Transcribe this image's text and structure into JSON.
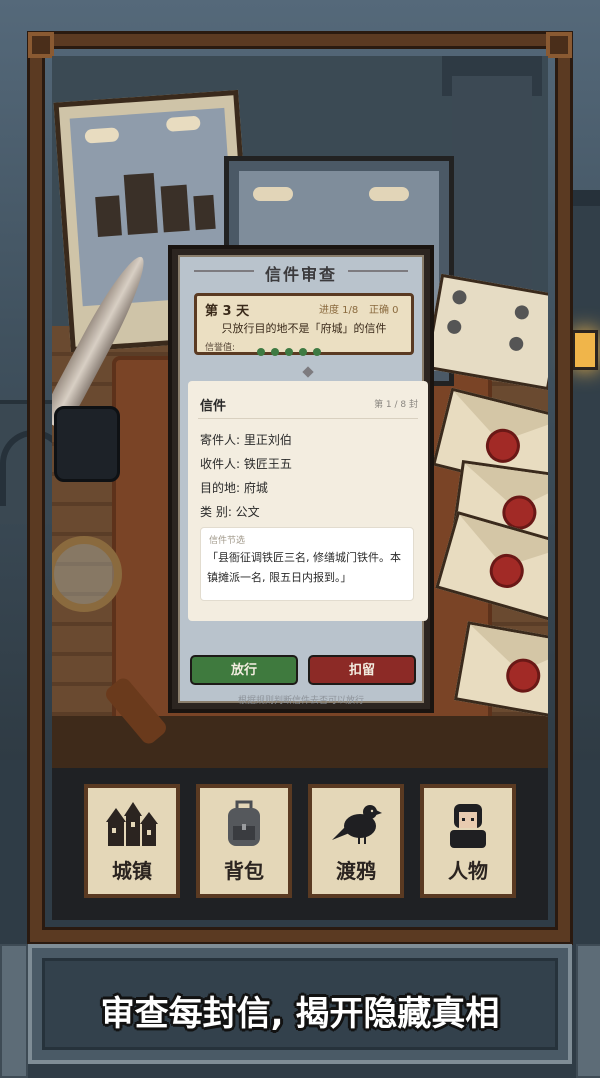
{
  "panel": {
    "title": "信件审查",
    "day": {
      "label": "第 3 天",
      "progress": "进度 1/8",
      "correct": "正确 0",
      "rule": "只放行目的地不是「府城」的信件",
      "trust_label": "信誉值:",
      "trust_level": 5
    },
    "letter": {
      "heading": "信件",
      "page": "第 1 / 8 封",
      "fields": [
        "寄件人: 里正刘伯",
        "收件人: 铁匠王五",
        "目的地: 府城",
        "类  别: 公文"
      ],
      "excerpt_label": "信件节选",
      "excerpt_text": "「县衙征调铁匠三名, 修缮城门铁件。本镇摊派一名, 限五日内报到。」"
    },
    "buttons": {
      "pass": "放行",
      "hold": "扣留"
    },
    "hint": "根据规则判断信件去否可以放行"
  },
  "menu": [
    {
      "label": "城镇",
      "icon": "town-icon"
    },
    {
      "label": "背包",
      "icon": "backpack-icon"
    },
    {
      "label": "渡鸦",
      "icon": "raven-icon"
    },
    {
      "label": "人物",
      "icon": "character-icon"
    }
  ],
  "caption": "审查每封信, 揭开隐藏真相",
  "colors": {
    "frame": "#5b3a22",
    "pass_button": "#3f7a3e",
    "hold_button": "#8c2a26",
    "panel_bg": "#b9c3cc",
    "seal": "#a22a26"
  }
}
